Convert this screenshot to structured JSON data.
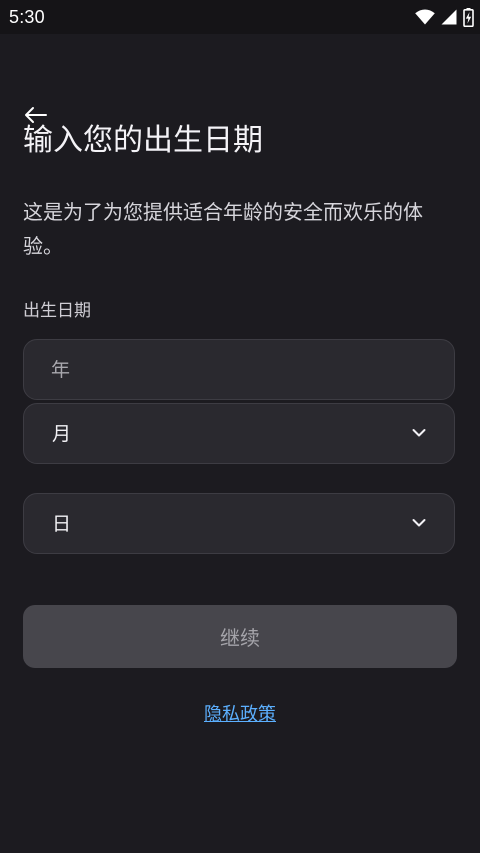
{
  "status_bar": {
    "time": "5:30",
    "icons": [
      "wifi-icon",
      "signal-icon",
      "battery-charging-icon"
    ]
  },
  "header": {
    "back_icon": "arrow-left-icon",
    "title": "输入您的出生日期",
    "description": "这是为了为您提供适合年龄的安全而欢乐的体验。"
  },
  "form": {
    "label": "出生日期",
    "year": {
      "placeholder": "年",
      "value": ""
    },
    "month": {
      "value": "月",
      "icon": "chevron-down-icon"
    },
    "day": {
      "value": "日",
      "icon": "chevron-down-icon"
    }
  },
  "actions": {
    "continue_label": "继续",
    "privacy_link_label": "隐私政策"
  },
  "colors": {
    "background": "#1c1b20",
    "field_background": "#2a292f",
    "button_disabled": "#47464c",
    "link": "#5cb0ff"
  }
}
